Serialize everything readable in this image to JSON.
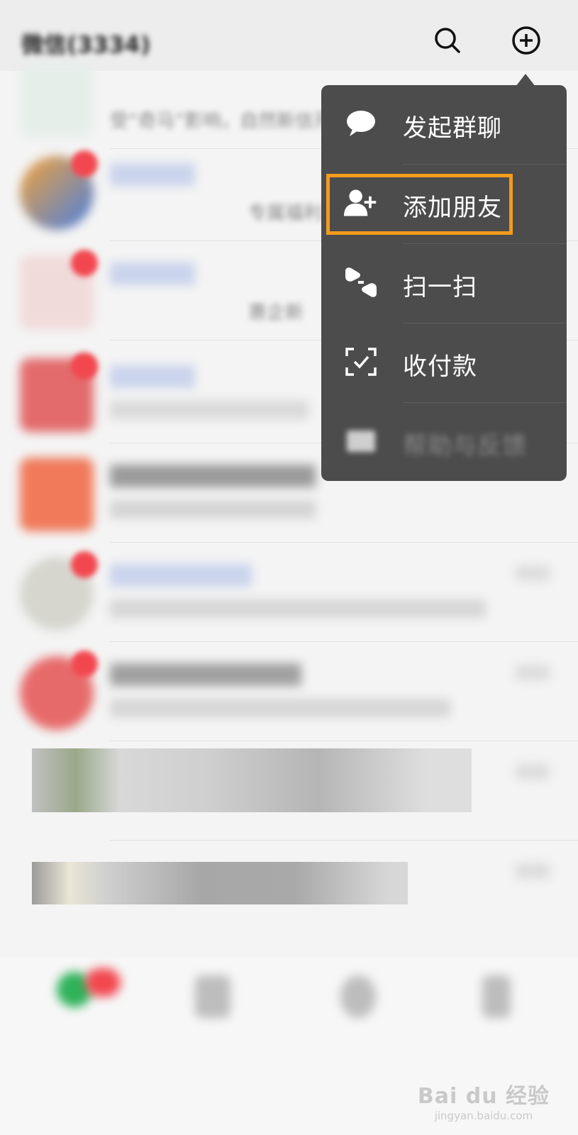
{
  "header": {
    "title": "微信(3334)",
    "search_icon": "search-icon",
    "add_icon": "plus-circle-icon"
  },
  "chats": [
    {
      "name": "",
      "preview": "受“奇马”影响，自然新信开放",
      "time": ""
    },
    {
      "name": "",
      "preview": "专属福利，",
      "time": ""
    },
    {
      "name": "",
      "preview": "惠企新",
      "time": ""
    },
    {
      "name": "",
      "preview": "",
      "time": ""
    },
    {
      "name": "",
      "preview": "",
      "time": ""
    },
    {
      "name": "",
      "preview": "",
      "time": ""
    },
    {
      "name": "",
      "preview": "",
      "time": ""
    },
    {
      "name": "",
      "preview": "",
      "time": ""
    },
    {
      "name": "",
      "preview": "",
      "time": ""
    }
  ],
  "menu": {
    "items": [
      {
        "label": "发起群聊",
        "icon": "chat-bubble-icon"
      },
      {
        "label": "添加朋友",
        "icon": "add-friend-icon"
      },
      {
        "label": "扫一扫",
        "icon": "scan-icon"
      },
      {
        "label": "收付款",
        "icon": "payment-icon"
      },
      {
        "label": "帮助与反馈",
        "icon": "help-mail-icon"
      }
    ],
    "highlighted_index": 1,
    "highlight_color": "#f29b1c",
    "background_color": "#4c4c4c"
  },
  "watermark": {
    "logo": "Bai du 经验",
    "sub": "jingyan.baidu.com"
  }
}
